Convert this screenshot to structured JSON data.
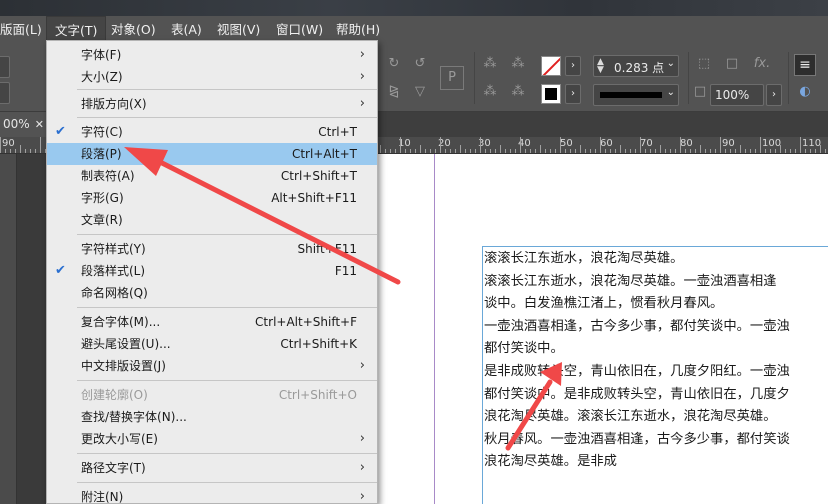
{
  "menubar": {
    "items": [
      "版面(L)",
      "文字(T)",
      "对象(O)",
      "表(A)",
      "视图(V)",
      "窗口(W)",
      "帮助(H)"
    ],
    "active_index": 1
  },
  "control_panel": {
    "stroke_weight": "0.283 点",
    "zoom_percent": "100%",
    "fx_label": "fx."
  },
  "document": {
    "tab_zoom": "00%",
    "tab_close": "✕"
  },
  "ruler": {
    "labels": [
      "90",
      "10",
      "20",
      "30",
      "40",
      "50",
      "60",
      "70",
      "80",
      "90",
      "100",
      "110",
      "120",
      "130"
    ]
  },
  "type_menu": {
    "items": [
      {
        "label": "字体(F)",
        "shortcut": "",
        "submenu": true,
        "checked": false,
        "disabled": false,
        "highlighted": false
      },
      {
        "label": "大小(Z)",
        "shortcut": "",
        "submenu": true,
        "checked": false,
        "disabled": false,
        "highlighted": false
      },
      {
        "label": "排版方向(X)",
        "shortcut": "",
        "submenu": true,
        "checked": false,
        "disabled": false,
        "highlighted": false
      },
      {
        "label": "字符(C)",
        "shortcut": "Ctrl+T",
        "submenu": false,
        "checked": true,
        "disabled": false,
        "highlighted": false
      },
      {
        "label": "段落(P)",
        "shortcut": "Ctrl+Alt+T",
        "submenu": false,
        "checked": false,
        "disabled": false,
        "highlighted": true
      },
      {
        "label": "制表符(A)",
        "shortcut": "Ctrl+Shift+T",
        "submenu": false,
        "checked": false,
        "disabled": false,
        "highlighted": false
      },
      {
        "label": "字形(G)",
        "shortcut": "Alt+Shift+F11",
        "submenu": false,
        "checked": false,
        "disabled": false,
        "highlighted": false
      },
      {
        "label": "文章(R)",
        "shortcut": "",
        "submenu": false,
        "checked": false,
        "disabled": false,
        "highlighted": false
      },
      {
        "label": "字符样式(Y)",
        "shortcut": "Shift+F11",
        "submenu": false,
        "checked": false,
        "disabled": false,
        "highlighted": false
      },
      {
        "label": "段落样式(L)",
        "shortcut": "F11",
        "submenu": false,
        "checked": true,
        "disabled": false,
        "highlighted": false
      },
      {
        "label": "命名网格(Q)",
        "shortcut": "",
        "submenu": false,
        "checked": false,
        "disabled": false,
        "highlighted": false
      },
      {
        "label": "复合字体(M)...",
        "shortcut": "Ctrl+Alt+Shift+F",
        "submenu": false,
        "checked": false,
        "disabled": false,
        "highlighted": false
      },
      {
        "label": "避头尾设置(U)...",
        "shortcut": "Ctrl+Shift+K",
        "submenu": false,
        "checked": false,
        "disabled": false,
        "highlighted": false
      },
      {
        "label": "中文排版设置(J)",
        "shortcut": "",
        "submenu": true,
        "checked": false,
        "disabled": false,
        "highlighted": false
      },
      {
        "label": "创建轮廓(O)",
        "shortcut": "Ctrl+Shift+O",
        "submenu": false,
        "checked": false,
        "disabled": true,
        "highlighted": false
      },
      {
        "label": "查找/替换字体(N)...",
        "shortcut": "",
        "submenu": false,
        "checked": false,
        "disabled": false,
        "highlighted": false
      },
      {
        "label": "更改大小写(E)",
        "shortcut": "",
        "submenu": true,
        "checked": false,
        "disabled": false,
        "highlighted": false
      },
      {
        "label": "路径文字(T)",
        "shortcut": "",
        "submenu": true,
        "checked": false,
        "disabled": false,
        "highlighted": false
      },
      {
        "label": "附注(N)",
        "shortcut": "",
        "submenu": true,
        "checked": false,
        "disabled": false,
        "highlighted": false
      }
    ]
  },
  "page_text": [
    "滚滚长江东逝水，浪花淘尽英雄。",
    "滚滚长江东逝水，浪花淘尽英雄。一壶浊酒喜相逢",
    "谈中。白发渔樵江渚上，惯看秋月春风。",
    "一壶浊酒喜相逢，古今多少事，都付笑谈中。一壶浊",
    "都付笑谈中。",
    "是非成败转头空，青山依旧在，几度夕阳红。一壶浊",
    "都付笑谈中。是非成败转头空，青山依旧在，几度夕",
    "浪花淘尽英雄。滚滚长江东逝水，浪花淘尽英雄。",
    "秋月春风。一壶浊酒喜相逢，古今多少事，都付笑谈",
    "浪花淘尽英雄。是非成"
  ],
  "colors": {
    "menu_highlight": "#99c9ef",
    "check_mark": "#2a6fd0",
    "annotation_arrow": "#f04848",
    "frame_edge": "#6aa8d8"
  }
}
